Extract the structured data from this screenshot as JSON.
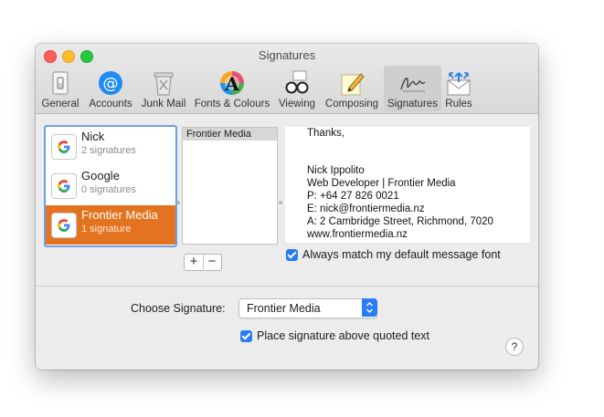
{
  "window": {
    "title": "Signatures"
  },
  "toolbar": {
    "items": [
      {
        "label": "General",
        "icon": "switch-icon"
      },
      {
        "label": "Accounts",
        "icon": "at-icon"
      },
      {
        "label": "Junk Mail",
        "icon": "trash-icon"
      },
      {
        "label": "Fonts & Colours",
        "icon": "font-color-icon"
      },
      {
        "label": "Viewing",
        "icon": "glasses-icon"
      },
      {
        "label": "Composing",
        "icon": "pencil-icon"
      },
      {
        "label": "Signatures",
        "icon": "signature-icon"
      },
      {
        "label": "Rules",
        "icon": "rules-icon"
      }
    ],
    "active": "Signatures"
  },
  "accounts": [
    {
      "name": "Nick",
      "count": "2 signatures"
    },
    {
      "name": "Google",
      "count": "0 signatures"
    },
    {
      "name": "Frontier Media",
      "count": "1 signature"
    }
  ],
  "signatures": [
    "Frontier Media"
  ],
  "signature_controls": {
    "add": "+",
    "remove": "−"
  },
  "preview": {
    "lines": [
      "Thanks,",
      "",
      "",
      "Nick Ippolito",
      "Web Developer | Frontier Media",
      "P: +64 27 826 0021",
      "E:  nick@frontiermedia.nz",
      "A: 2 Cambridge Street, Richmond, 7020",
      "www.frontiermedia.nz"
    ]
  },
  "options": {
    "match_font": "Always match my default message font",
    "choose_label": "Choose Signature:",
    "choose_value": "Frontier Media",
    "place_above": "Place signature above quoted text",
    "help": "?"
  },
  "colors": {
    "accent": "#2a7cf6",
    "selection": "#e3731f"
  }
}
